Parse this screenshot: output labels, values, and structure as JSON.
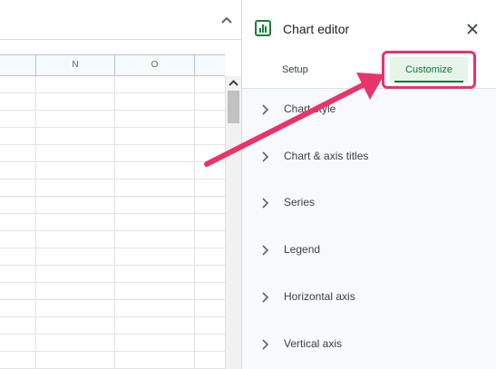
{
  "sheet": {
    "columns": [
      "",
      "N",
      "O",
      ""
    ]
  },
  "panel": {
    "title": "Chart editor",
    "tabs": {
      "setup": "Setup",
      "customize": "Customize"
    },
    "sections": [
      "Chart style",
      "Chart & axis titles",
      "Series",
      "Legend",
      "Horizontal axis",
      "Vertical axis"
    ]
  },
  "icons": {
    "chart": "bar-chart-icon",
    "close": "close-icon",
    "expand": "chevron-right-icon",
    "collapse": "chevron-up-icon"
  },
  "colors": {
    "accent": "#137333",
    "active_tab_bg": "#e6f4ea",
    "annotation": "#e8336b"
  }
}
